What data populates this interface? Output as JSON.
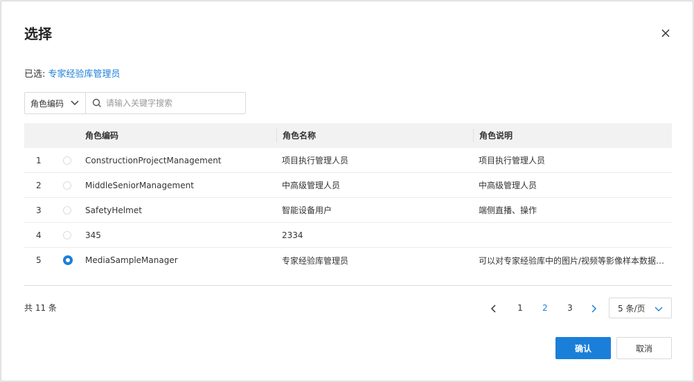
{
  "dialog": {
    "title": "选择",
    "close_icon": "close-icon"
  },
  "selected": {
    "label": "已选:",
    "value": "专家经验库管理员"
  },
  "search": {
    "filter_value": "角色编码",
    "placeholder": "请输入关键字搜索"
  },
  "table": {
    "headers": {
      "code": "角色编码",
      "name": "角色名称",
      "desc": "角色说明"
    },
    "rows": [
      {
        "idx": "1",
        "code": "ConstructionProjectManagement",
        "name": "项目执行管理人员",
        "desc": "项目执行管理人员",
        "checked": false
      },
      {
        "idx": "2",
        "code": "MiddleSeniorManagement",
        "name": "中高级管理人员",
        "desc": "中高级管理人员",
        "checked": false
      },
      {
        "idx": "3",
        "code": "SafetyHelmet",
        "name": "智能设备用户",
        "desc": "端侧直播、操作",
        "checked": false
      },
      {
        "idx": "4",
        "code": "345",
        "name": "2334",
        "desc": "",
        "checked": false
      },
      {
        "idx": "5",
        "code": "MediaSampleManager",
        "name": "专家经验库管理员",
        "desc": "可以对专家经验库中的图片/视频等影像样本数据…",
        "checked": true
      }
    ]
  },
  "pagination": {
    "total_text": "共 11 条",
    "pages": [
      "1",
      "2",
      "3"
    ],
    "current_page": "2",
    "page_size": "5 条/页"
  },
  "footer": {
    "ok_label": "确认",
    "cancel_label": "取消"
  },
  "colors": {
    "accent": "#1a7fd9",
    "header_bg": "#f2f2f2"
  }
}
